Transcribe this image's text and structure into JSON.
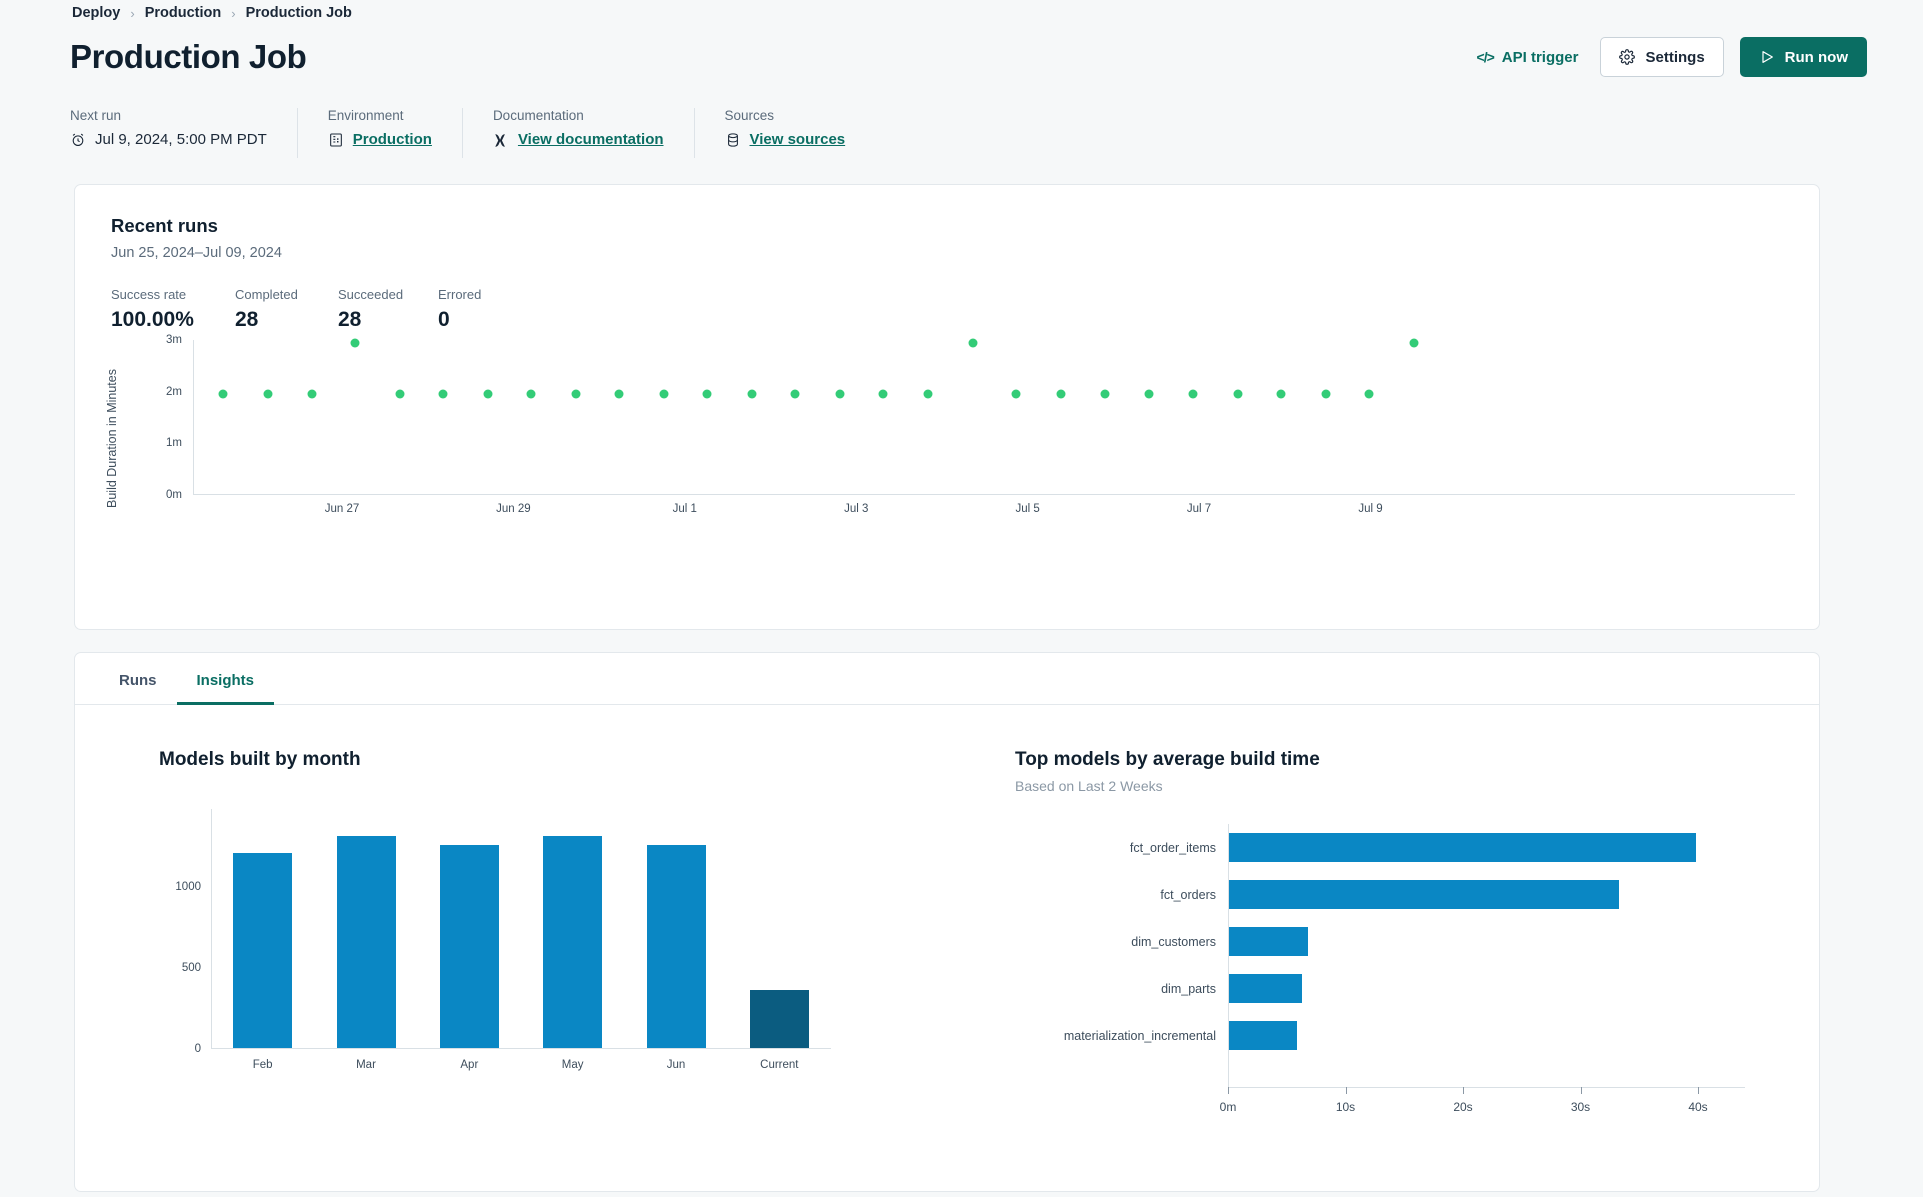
{
  "breadcrumb": {
    "items": [
      "Deploy",
      "Production",
      "Production Job"
    ],
    "separator": "›"
  },
  "header": {
    "title": "Production Job",
    "api_trigger_label": "API trigger",
    "api_trigger_icon": "code-icon",
    "settings_label": "Settings",
    "settings_icon": "gear-icon",
    "run_now_label": "Run now",
    "run_now_icon": "play-icon",
    "primary_color": "#0a6e63"
  },
  "meta": [
    {
      "label": "Next run",
      "value": "Jul 9, 2024, 5:00 PM PDT",
      "icon": "alarm-clock-icon",
      "link": false
    },
    {
      "label": "Environment",
      "value": "Production",
      "icon": "server-icon",
      "link": true
    },
    {
      "label": "Documentation",
      "value": "View documentation",
      "icon": "dbt-logo-icon",
      "link": true
    },
    {
      "label": "Sources",
      "value": "View sources",
      "icon": "database-icon",
      "link": true
    }
  ],
  "recent_runs": {
    "title": "Recent runs",
    "date_range": "Jun 25, 2024–Jul 09, 2024",
    "stats": [
      {
        "label": "Success rate",
        "value": "100.00%"
      },
      {
        "label": "Completed",
        "value": "28"
      },
      {
        "label": "Succeeded",
        "value": "28"
      },
      {
        "label": "Errored",
        "value": "0"
      }
    ]
  },
  "tabs": [
    {
      "label": "Runs",
      "active": false
    },
    {
      "label": "Insights",
      "active": true
    }
  ],
  "insights": {
    "left_title": "Models built by month",
    "right_title": "Top models by average build time",
    "right_subtitle": "Based on Last 2 Weeks"
  },
  "chart_data": [
    {
      "type": "scatter",
      "title": "Recent runs",
      "xlabel": "",
      "ylabel": "Build Duration in Minutes",
      "dot_color": "#33cc77",
      "ytick_labels": [
        "0m",
        "1m",
        "2m",
        "3m"
      ],
      "ytick_values": [
        0,
        1,
        2,
        3
      ],
      "ylim": [
        0,
        3
      ],
      "xtick_labels": [
        "Jun 27",
        "Jun 29",
        "Jul 1",
        "Jul 3",
        "Jul 5",
        "Jul 7",
        "Jul 9"
      ],
      "xtick_positions": [
        0.093,
        0.2,
        0.307,
        0.414,
        0.521,
        0.628,
        0.735
      ],
      "points": [
        {
          "x": 0.019,
          "y": 1.95
        },
        {
          "x": 0.047,
          "y": 1.95
        },
        {
          "x": 0.074,
          "y": 1.95
        },
        {
          "x": 0.101,
          "y": 2.95
        },
        {
          "x": 0.129,
          "y": 1.95
        },
        {
          "x": 0.156,
          "y": 1.95
        },
        {
          "x": 0.184,
          "y": 1.95
        },
        {
          "x": 0.211,
          "y": 1.95
        },
        {
          "x": 0.239,
          "y": 1.95
        },
        {
          "x": 0.266,
          "y": 1.95
        },
        {
          "x": 0.294,
          "y": 1.95
        },
        {
          "x": 0.321,
          "y": 1.95
        },
        {
          "x": 0.349,
          "y": 1.95
        },
        {
          "x": 0.376,
          "y": 1.95
        },
        {
          "x": 0.404,
          "y": 1.95
        },
        {
          "x": 0.431,
          "y": 1.95
        },
        {
          "x": 0.459,
          "y": 1.95
        },
        {
          "x": 0.487,
          "y": 2.95
        },
        {
          "x": 0.514,
          "y": 1.95
        },
        {
          "x": 0.542,
          "y": 1.95
        },
        {
          "x": 0.569,
          "y": 1.95
        },
        {
          "x": 0.597,
          "y": 1.95
        },
        {
          "x": 0.624,
          "y": 1.95
        },
        {
          "x": 0.652,
          "y": 1.95
        },
        {
          "x": 0.679,
          "y": 1.95
        },
        {
          "x": 0.707,
          "y": 1.95
        },
        {
          "x": 0.734,
          "y": 1.95
        },
        {
          "x": 0.762,
          "y": 2.95
        }
      ]
    },
    {
      "type": "bar",
      "title": "Models built by month",
      "xlabel": "",
      "ylabel": "",
      "categories": [
        "Feb",
        "Mar",
        "Apr",
        "May",
        "Jun",
        "Current"
      ],
      "values": [
        1205,
        1310,
        1255,
        1305,
        1250,
        360
      ],
      "ylim": [
        0,
        1480
      ],
      "ytick_labels": [
        "0",
        "500",
        "1000"
      ],
      "ytick_values": [
        0,
        500,
        1000
      ],
      "bar_color": "#0a87c4",
      "highlight_index": 5,
      "highlight_color": "#0b5c80"
    },
    {
      "type": "bar",
      "orientation": "horizontal",
      "title": "Top models by average build time",
      "subtitle": "Based on Last 2 Weeks",
      "categories": [
        "fct_order_items",
        "fct_orders",
        "dim_customers",
        "dim_parts",
        "materialization_incremental"
      ],
      "values": [
        39.8,
        33.3,
        6.8,
        6.3,
        5.9
      ],
      "unit": "s",
      "xlim": [
        0,
        44
      ],
      "xtick_labels": [
        "0m",
        "10s",
        "20s",
        "30s",
        "40s"
      ],
      "xtick_values": [
        0,
        10,
        20,
        30,
        40
      ],
      "bar_color": "#0a87c4"
    }
  ]
}
